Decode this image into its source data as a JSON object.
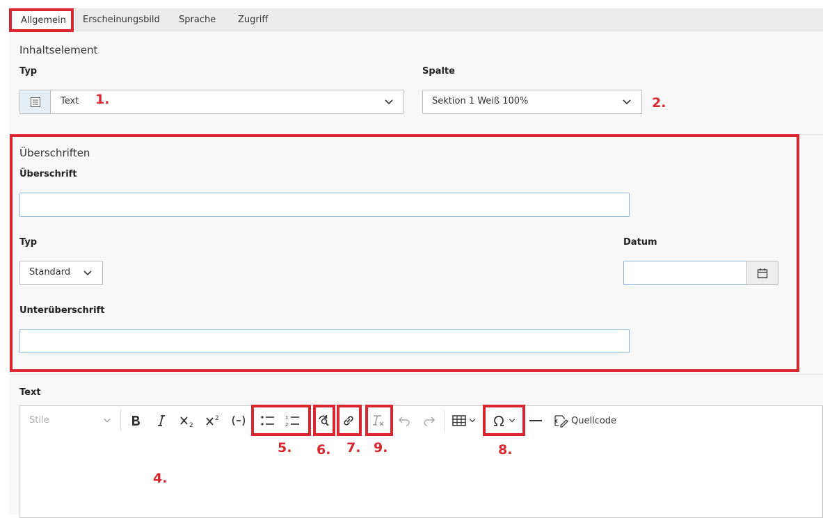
{
  "tabs": [
    {
      "label": "Allgemein",
      "active": true
    },
    {
      "label": "Erscheinungsbild",
      "active": false
    },
    {
      "label": "Sprache",
      "active": false
    },
    {
      "label": "Zugriff",
      "active": false
    }
  ],
  "content_element": {
    "section_title": "Inhaltselement",
    "type_label": "Typ",
    "type_value": "Text",
    "column_label": "Spalte",
    "column_value": "Sektion 1 Weiß 100%"
  },
  "headings": {
    "section_title": "Überschriften",
    "heading_label": "Überschrift",
    "heading_value": "",
    "type_label": "Typ",
    "type_value": "Standard",
    "date_label": "Datum",
    "date_value": "",
    "subheading_label": "Unterüberschrift",
    "subheading_value": ""
  },
  "text_editor": {
    "label": "Text",
    "style_placeholder": "Stile",
    "source_label": "Quellcode",
    "body": ""
  },
  "annotations": {
    "n1": "1.",
    "n2": "2.",
    "n4": "4.",
    "n5": "5.",
    "n6": "6.",
    "n7": "7.",
    "n8": "8.",
    "n9": "9."
  },
  "colors": {
    "annotation_red": "#d9262f",
    "input_border": "#8fb3d6",
    "panel_bg": "#f8f8f8"
  }
}
